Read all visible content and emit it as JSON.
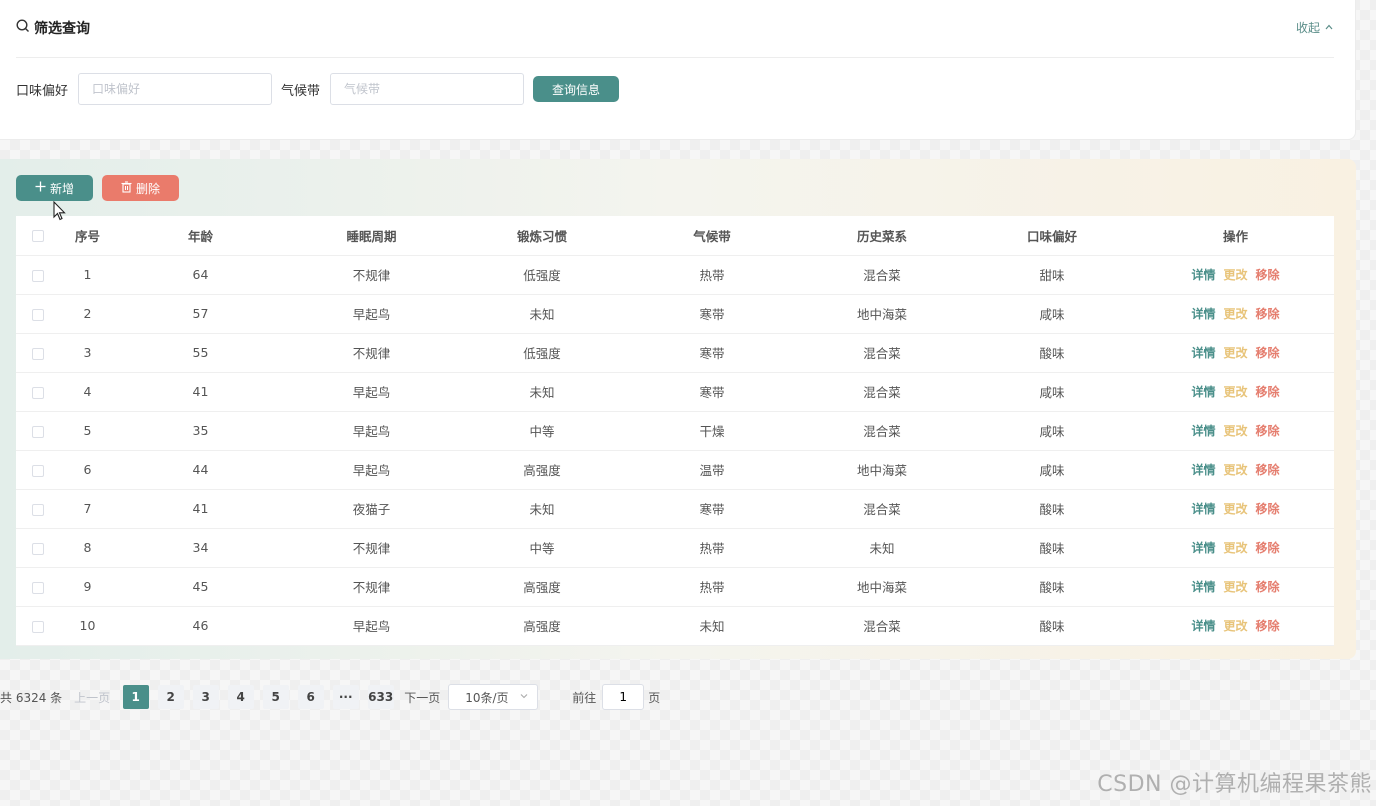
{
  "filter": {
    "title": "筛选查询",
    "collapse_label": "收起",
    "taste_label": "口味偏好",
    "taste_placeholder": "口味偏好",
    "climate_label": "气候带",
    "climate_placeholder": "气候带",
    "query_label": "查询信息"
  },
  "toolbar": {
    "add_label": "新增",
    "delete_label": "删除"
  },
  "table": {
    "headers": [
      "序号",
      "年龄",
      "睡眠周期",
      "锻炼习惯",
      "气候带",
      "历史菜系",
      "口味偏好",
      "操作"
    ],
    "ops": {
      "detail": "详情",
      "edit": "更改",
      "remove": "移除"
    },
    "rows": [
      {
        "no": "1",
        "age": "64",
        "sleep": "不规律",
        "exercise": "低强度",
        "climate": "热带",
        "cuisine": "混合菜",
        "taste": "甜味"
      },
      {
        "no": "2",
        "age": "57",
        "sleep": "早起鸟",
        "exercise": "未知",
        "climate": "寒带",
        "cuisine": "地中海菜",
        "taste": "咸味"
      },
      {
        "no": "3",
        "age": "55",
        "sleep": "不规律",
        "exercise": "低强度",
        "climate": "寒带",
        "cuisine": "混合菜",
        "taste": "酸味"
      },
      {
        "no": "4",
        "age": "41",
        "sleep": "早起鸟",
        "exercise": "未知",
        "climate": "寒带",
        "cuisine": "混合菜",
        "taste": "咸味"
      },
      {
        "no": "5",
        "age": "35",
        "sleep": "早起鸟",
        "exercise": "中等",
        "climate": "干燥",
        "cuisine": "混合菜",
        "taste": "咸味"
      },
      {
        "no": "6",
        "age": "44",
        "sleep": "早起鸟",
        "exercise": "高强度",
        "climate": "温带",
        "cuisine": "地中海菜",
        "taste": "咸味"
      },
      {
        "no": "7",
        "age": "41",
        "sleep": "夜猫子",
        "exercise": "未知",
        "climate": "寒带",
        "cuisine": "混合菜",
        "taste": "酸味"
      },
      {
        "no": "8",
        "age": "34",
        "sleep": "不规律",
        "exercise": "中等",
        "climate": "热带",
        "cuisine": "未知",
        "taste": "酸味"
      },
      {
        "no": "9",
        "age": "45",
        "sleep": "不规律",
        "exercise": "高强度",
        "climate": "热带",
        "cuisine": "地中海菜",
        "taste": "酸味"
      },
      {
        "no": "10",
        "age": "46",
        "sleep": "早起鸟",
        "exercise": "高强度",
        "climate": "未知",
        "cuisine": "混合菜",
        "taste": "酸味"
      }
    ]
  },
  "pagination": {
    "total": "共 6324 条",
    "prev": "上一页",
    "pages": [
      "1",
      "2",
      "3",
      "4",
      "5",
      "6",
      "···",
      "633"
    ],
    "current": "1",
    "next": "下一页",
    "page_size": "10条/页",
    "goto_label": "前往",
    "goto_value": "1",
    "goto_suffix": "页"
  },
  "watermark": "CSDN @计算机编程果茶熊",
  "colors": {
    "primary": "#4a8f8a",
    "danger": "#ea7b6b",
    "edit": "#e8c47a"
  }
}
